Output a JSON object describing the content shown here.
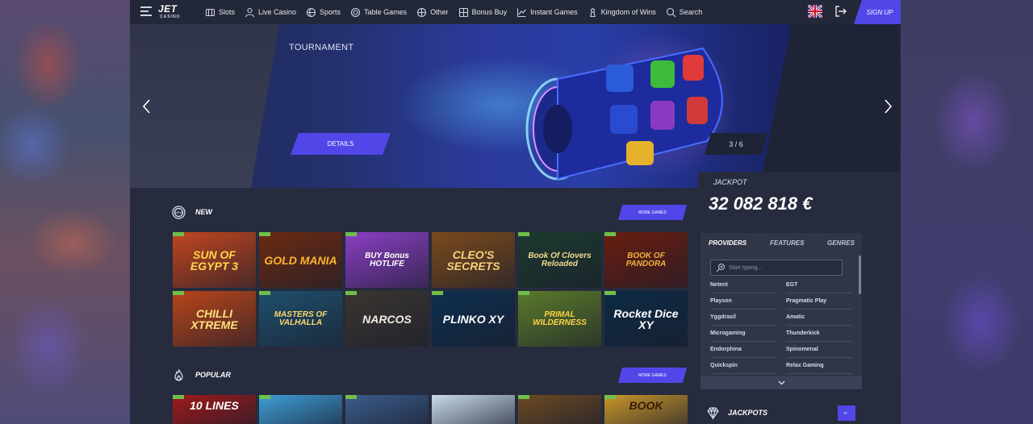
{
  "nav": {
    "logo_main": "JET",
    "logo_sub": "CASINO",
    "items": [
      {
        "label": "Slots",
        "icon": "slot-machine-icon"
      },
      {
        "label": "Live Casino",
        "icon": "live-dealer-icon"
      },
      {
        "label": "Sports",
        "icon": "sports-ball-icon"
      },
      {
        "label": "Table Games",
        "icon": "poker-chip-icon"
      },
      {
        "label": "Other",
        "icon": "other-games-icon"
      },
      {
        "label": "Bonus Buy",
        "icon": "bonus-buy-icon"
      },
      {
        "label": "Instant Games",
        "icon": "chart-line-icon"
      },
      {
        "label": "Kingdom of Wins",
        "icon": "chess-piece-icon"
      },
      {
        "label": "Search",
        "icon": "search-icon"
      }
    ],
    "signup_label": "SIGN UP",
    "language_flag": "uk-flag-icon"
  },
  "banner": {
    "label": "TOURNAMENT",
    "details_label": "DETAILS",
    "slide_counter": "3 / 6"
  },
  "jackpot": {
    "label": "JACKPOT",
    "amount": "32 082 818 €"
  },
  "sections": {
    "new": {
      "title": "NEW",
      "more_label": "MORE GAMES",
      "games": [
        {
          "title": "SUN OF EGYPT 3",
          "bg": "#c0461e",
          "color": "#ffd84a",
          "badge": true
        },
        {
          "title": "GOLD MANIA",
          "bg": "#6b2a12",
          "color": "#ffb52b",
          "badge": true
        },
        {
          "title": "BUY Bonus HOTLIFE",
          "bg": "#8a3fc2",
          "color": "#ffffff",
          "badge": true
        },
        {
          "title": "CLEO'S SECRETS",
          "bg": "#7a4a1c",
          "color": "#f6d27a",
          "badge": false
        },
        {
          "title": "Book Of Clovers Reloaded",
          "bg": "#1c3a2e",
          "color": "#f3d98a",
          "badge": true
        },
        {
          "title": "BOOK OF PANDORA",
          "bg": "#6a1d10",
          "color": "#f0b23c",
          "badge": true
        },
        {
          "title": "CHILLI XTREME",
          "bg": "#b8451a",
          "color": "#ffe27a",
          "badge": true
        },
        {
          "title": "MASTERS OF VALHALLA",
          "bg": "#1f4f6c",
          "color": "#ffd86a",
          "badge": true
        },
        {
          "title": "NARCOS",
          "bg": "#3a3530",
          "color": "#f1ece4",
          "badge": true
        },
        {
          "title": "PLINKO XY",
          "bg": "#0e2f4e",
          "color": "#ffffff",
          "badge": true
        },
        {
          "title": "PRIMAL WILDERNESS",
          "bg": "#5a7a2a",
          "color": "#ffd24a",
          "badge": true
        },
        {
          "title": "Rocket Dice XY",
          "bg": "#0d2a45",
          "color": "#ffffff",
          "badge": true
        }
      ]
    },
    "popular": {
      "title": "POPULAR",
      "more_label": "MORE GAMES",
      "games": [
        {
          "title": "10 LINES",
          "bg": "#a01a1a",
          "color": "#ffffff",
          "badge": true
        },
        {
          "title": "",
          "bg": "#3e9fd8",
          "color": "#ffffff",
          "badge": true
        },
        {
          "title": "",
          "bg": "#3b5d8c",
          "color": "#ffffff",
          "badge": true
        },
        {
          "title": "",
          "bg": "#c9dbe8",
          "color": "#ffffff",
          "badge": false
        },
        {
          "title": "",
          "bg": "#6b4a22",
          "color": "#ffffff",
          "badge": true
        },
        {
          "title": "BOOK",
          "bg": "#c8962a",
          "color": "#3a1a06",
          "badge": true
        }
      ]
    }
  },
  "providers": {
    "tabs": [
      "PROVIDERS",
      "FEATURES",
      "GENRES"
    ],
    "search_placeholder": "Start typing...",
    "items": [
      "Netent",
      "EGT",
      "Playson",
      "Pragmatic Play",
      "Yggdrasil",
      "Amatic",
      "Microgaming",
      "Thunderkick",
      "Endorphina",
      "Spinomenal",
      "Quickspin",
      "Relax Gaming"
    ]
  },
  "jackpots_section": {
    "title": "JACKPOTS"
  },
  "colors": {
    "accent": "#5147e8",
    "panel": "#303548",
    "background": "#262b3e"
  }
}
